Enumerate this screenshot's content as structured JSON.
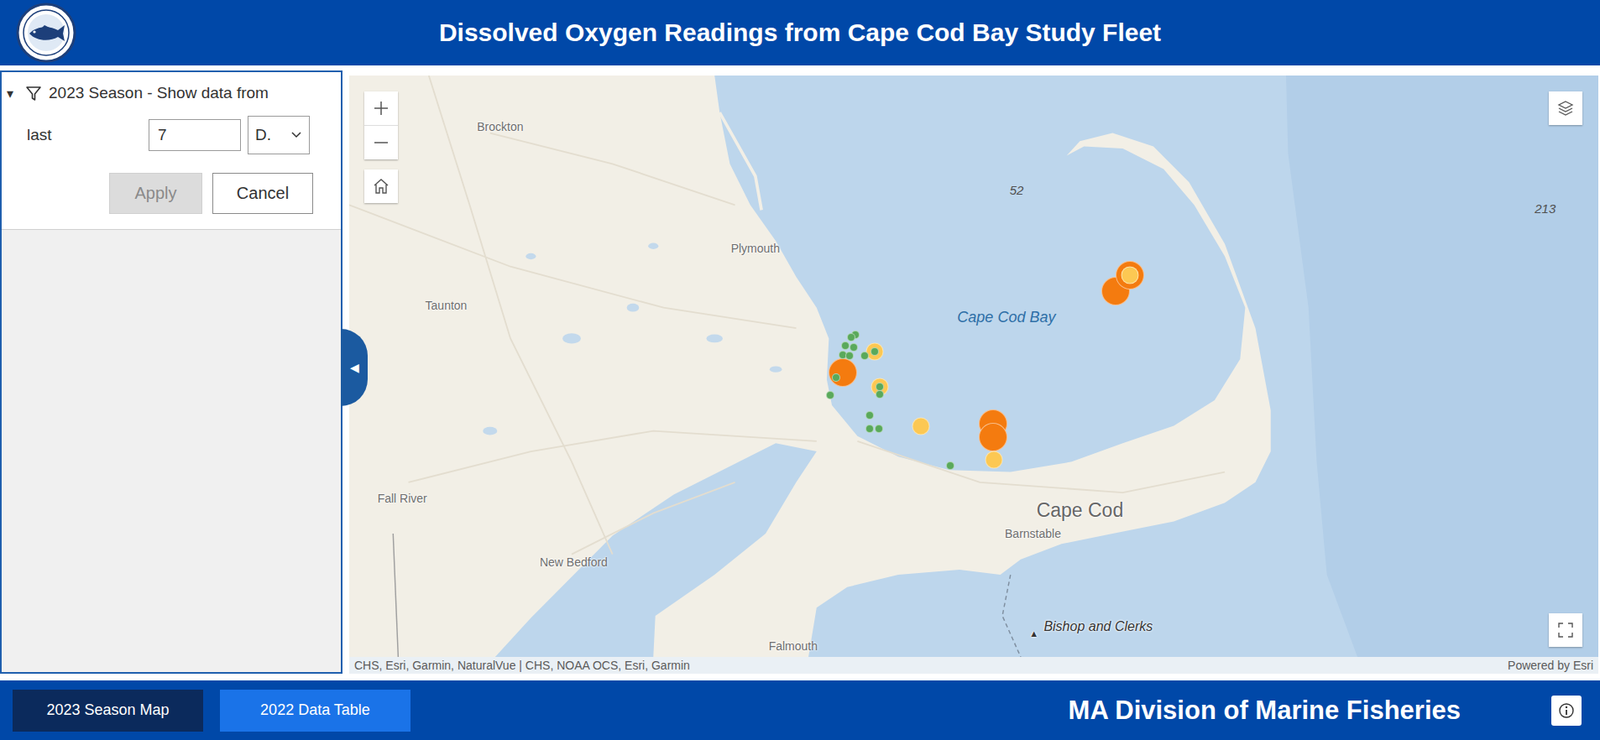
{
  "header": {
    "title": "Dissolved Oxygen Readings from Cape Cod Bay Study Fleet"
  },
  "filter": {
    "toggle": "▾",
    "title": "2023 Season - Show data from",
    "label": "last",
    "value": "7",
    "unit": "D.",
    "apply": {
      "label": "Apply",
      "disabled": true
    },
    "cancel": {
      "label": "Cancel"
    }
  },
  "panel_toggle": "◀",
  "map": {
    "labels": [
      {
        "text": "Brockton",
        "kind": "town"
      },
      {
        "text": "Plymouth",
        "kind": "town"
      },
      {
        "text": "Taunton",
        "kind": "town"
      },
      {
        "text": "Fall River",
        "kind": "town"
      },
      {
        "text": "New Bedford",
        "kind": "town"
      },
      {
        "text": "Falmouth",
        "kind": "town"
      },
      {
        "text": "Barnstable",
        "kind": "town"
      },
      {
        "text": "Cape Cod Bay",
        "kind": "water"
      },
      {
        "text": "Cape Cod",
        "kind": "region"
      },
      {
        "text": "52",
        "kind": "depth"
      },
      {
        "text": "213",
        "kind": "depth"
      },
      {
        "text": "▲",
        "kind": "marker"
      },
      {
        "text": "Bishop and Clerks",
        "kind": "landmark"
      }
    ],
    "readings": [
      {
        "color": "#f47b0f"
      },
      {
        "color": "#f47b0f"
      },
      {
        "color": "#f47b0f"
      },
      {
        "color": "#f47b0f"
      },
      {
        "color": "#f47b0f"
      },
      {
        "color": "#fcc853"
      },
      {
        "color": "#fcc853"
      },
      {
        "color": "#fcc853"
      },
      {
        "color": "#fcc853"
      },
      {
        "color": "#fcc853"
      },
      {
        "color": "#5aa95b"
      },
      {
        "color": "#5aa95b"
      },
      {
        "color": "#5aa95b"
      },
      {
        "color": "#5aa95b"
      },
      {
        "color": "#5aa95b"
      },
      {
        "color": "#5aa95b"
      },
      {
        "color": "#5aa95b"
      },
      {
        "color": "#5aa95b"
      },
      {
        "color": "#5aa95b"
      },
      {
        "color": "#5aa95b"
      },
      {
        "color": "#5aa95b"
      },
      {
        "color": "#5aa95b"
      },
      {
        "color": "#5aa95b"
      },
      {
        "color": "#5aa95b"
      },
      {
        "color": "#5aa95b"
      },
      {
        "color": "#5aa95b"
      }
    ],
    "attribution": "CHS, Esri, Garmin, NaturalVue | CHS, NOAA OCS, Esri, Garmin",
    "powered_by": "Powered by Esri"
  },
  "footer": {
    "tabs": [
      {
        "label": "2023 Season Map",
        "selected": true
      },
      {
        "label": "2022 Data Table",
        "selected": false
      }
    ],
    "agency": "MA Division of Marine Fisheries"
  }
}
